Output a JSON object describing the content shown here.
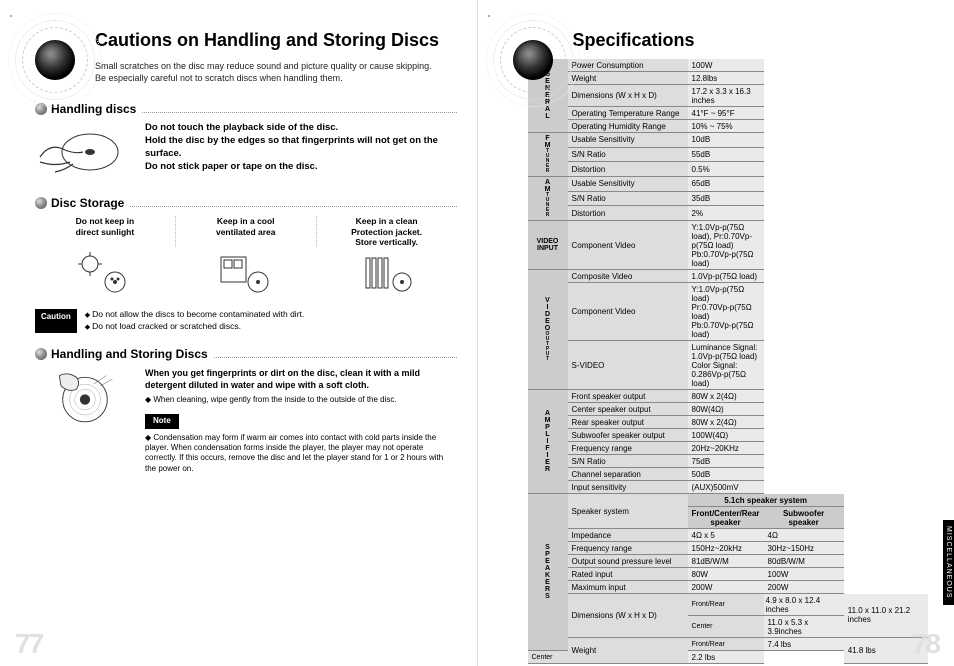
{
  "left": {
    "title": "Cautions on Handling and Storing Discs",
    "intro": "Small scratches on the disc may reduce sound and picture quality or cause skipping.\nBe especially careful not to scratch discs when handling them.",
    "handling": {
      "heading": "Handling discs",
      "line1": "Do not touch the playback side of the disc.",
      "line2": "Hold the disc by the edges so that fingerprints will not get on the surface.",
      "line3": "Do not stick paper or tape on the disc."
    },
    "storage": {
      "heading": "Disc Storage",
      "c1a": "Do not keep in",
      "c1b": "direct sunlight",
      "c2a": "Keep in a cool",
      "c2b": "ventilated area",
      "c3a": "Keep in a clean",
      "c3b": "Protection jacket.",
      "c3c": "Store vertically."
    },
    "caution_label": "Caution",
    "caution_items": {
      "a": "Do not allow the discs to become contaminated with dirt.",
      "b": "Do not load cracked or scratched discs."
    },
    "clean": {
      "heading": "Handling and Storing Discs",
      "bold": "When you get fingerprints or dirt on the disc, clean it with a mild detergent diluted in water and wipe with a soft cloth.",
      "bullet": "When cleaning, wipe gently from the inside to the outside of the disc."
    },
    "note_label": "Note",
    "note_text": "Condensation may form if warm air comes into contact with cold parts inside the player. When condensation forms inside the player, the player may not operate correctly. If this occurs, remove the disc and let the player stand for 1 or 2 hours with the power on.",
    "pagenum": "77"
  },
  "right": {
    "title": "Specifications",
    "pagenum": "78",
    "side_tab": "MISCELLANEOUS",
    "groups": {
      "general": [
        "G",
        "E",
        "N",
        "E",
        "R",
        "A",
        "L"
      ],
      "fm": [
        "F",
        "M"
      ],
      "fm_small": [
        "T",
        "U",
        "N",
        "E",
        "R"
      ],
      "am": [
        "A",
        "M"
      ],
      "am_small": [
        "T",
        "U",
        "N",
        "E",
        "R"
      ],
      "video_in": "VIDEO INPUT",
      "video": [
        "V",
        "I",
        "D",
        "E",
        "O"
      ],
      "video_small": [
        "O",
        "U",
        "T",
        "P",
        "U",
        "T"
      ],
      "amp": [
        "A",
        "M",
        "P",
        "L",
        "I",
        "F",
        "I",
        "E",
        "R"
      ],
      "spk": [
        "S",
        "P",
        "E",
        "A",
        "K",
        "E",
        "R",
        "S"
      ]
    },
    "specs": {
      "general": [
        {
          "p": "Power Consumption",
          "v": "100W"
        },
        {
          "p": "Weight",
          "v": "12.8lbs"
        },
        {
          "p": "Dimensions (W x H x D)",
          "v": "17.2 x 3.3 x 16.3 inches"
        },
        {
          "p": "Operating Temperature Range",
          "v": "41°F ~ 95°F"
        },
        {
          "p": "Operating Humidity Range",
          "v": "10% ~ 75%"
        }
      ],
      "fm": [
        {
          "p": "Usable Sensitivity",
          "v": "10dB"
        },
        {
          "p": "S/N Ratio",
          "v": "55dB"
        },
        {
          "p": "Distortion",
          "v": "0.5%"
        }
      ],
      "am": [
        {
          "p": "Usable Sensitivity",
          "v": "65dB"
        },
        {
          "p": "S/N Ratio",
          "v": "35dB"
        },
        {
          "p": "Distortion",
          "v": "2%"
        }
      ],
      "video_in": [
        {
          "p": "Component Video",
          "v": "Y:1.0Vp-p(75Ω load), Pr:0.70Vp-p(75Ω load)\nPb:0.70Vp-p(75Ω load)"
        }
      ],
      "video_out": [
        {
          "p": "Composite Video",
          "v": "1.0Vp-p(75Ω load)"
        },
        {
          "p": "Component Video",
          "v": "Y:1.0Vp-p(75Ω load)\nPr:0.70Vp-p(75Ω load)\nPb:0.70Vp-p(75Ω load)"
        },
        {
          "p": "S-VIDEO",
          "v": "Luminance Signal: 1.0Vp-p(75Ω load)\nColor Signal: 0.286Vp-p(75Ω load)"
        }
      ],
      "amp": [
        {
          "p": "Front speaker output",
          "v": "80W x 2(4Ω)"
        },
        {
          "p": "Center speaker output",
          "v": "80W(4Ω)"
        },
        {
          "p": "Rear speaker output",
          "v": "80W x 2(4Ω)"
        },
        {
          "p": "Subwoofer speaker output",
          "v": "100W(4Ω)"
        },
        {
          "p": "Frequency range",
          "v": "20Hz~20KHz"
        },
        {
          "p": "S/N Ratio",
          "v": "75dB"
        },
        {
          "p": "Channel separation",
          "v": "50dB"
        },
        {
          "p": "Input sensitivity",
          "v": "(AUX)500mV"
        }
      ],
      "spk": {
        "header_main": "5.1ch speaker system",
        "col1": "Front/Center/Rear speaker",
        "col2": "Subwoofer speaker",
        "rows": [
          {
            "p": "Impedance",
            "a": "4Ω x 5",
            "b": "4Ω"
          },
          {
            "p": "Frequency range",
            "a": "150Hz~20kHz",
            "b": "30Hz~150Hz"
          },
          {
            "p": "Output sound pressure level",
            "a": "81dB/W/M",
            "b": "80dB/W/M"
          },
          {
            "p": "Rated input",
            "a": "80W",
            "b": "100W"
          },
          {
            "p": "Maximum input",
            "a": "200W",
            "b": "200W"
          }
        ],
        "dim_label": "Dimensions  (W x H x D)",
        "dim_fr_label": "Front/Rear",
        "dim_fr_val": "4.9 x 8.0 x 12.4 inches",
        "dim_c_label": "Center",
        "dim_c_val": "11.0 x 5.3 x 3.9inches",
        "dim_sub": "11.0 x 11.0 x 21.2 inches",
        "wt_label": "Weight",
        "wt_fr_label": "Front/Rear",
        "wt_fr_val": "7.4 lbs",
        "wt_c_label": "Center",
        "wt_c_val": "2.2 lbs",
        "wt_sub": "41.8 lbs"
      }
    }
  }
}
